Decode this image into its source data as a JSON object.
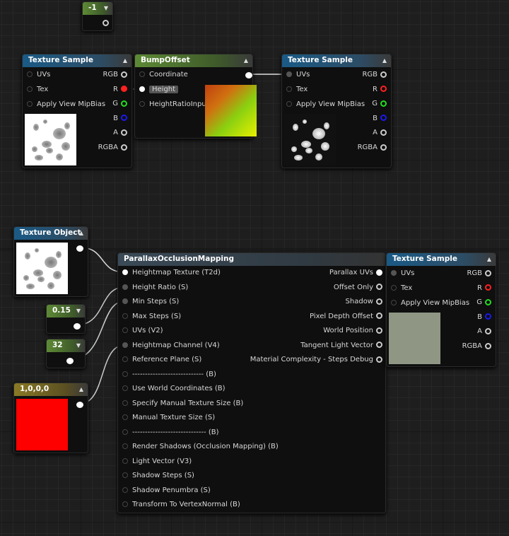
{
  "nodes": {
    "const_neg1": {
      "value": "-1"
    },
    "tex1": {
      "title": "Texture Sample",
      "inputs": [
        "UVs",
        "Tex",
        "Apply View MipBias"
      ],
      "outputs": [
        "RGB",
        "R",
        "G",
        "B",
        "A",
        "RGBA"
      ]
    },
    "bump": {
      "title": "BumpOffset",
      "inputs": [
        "Coordinate",
        "Height",
        "HeightRatioInput"
      ]
    },
    "tex2": {
      "title": "Texture Sample",
      "inputs": [
        "UVs",
        "Tex",
        "Apply View MipBias"
      ],
      "outputs": [
        "RGB",
        "R",
        "G",
        "B",
        "A",
        "RGBA"
      ]
    },
    "texobj": {
      "title": "Texture Object"
    },
    "const_015": {
      "value": "0.15"
    },
    "const_32": {
      "value": "32"
    },
    "vec4": {
      "title": "1,0,0,0"
    },
    "pom": {
      "title": "ParallaxOcclusionMapping",
      "inputs": [
        "Heightmap Texture (T2d)",
        "Height Ratio (S)",
        "Min Steps (S)",
        "Max Steps (S)",
        "UVs (V2)",
        "Heightmap Channel (V4)",
        "Reference Plane (S)",
        "---------------------------- (B)",
        "Use World Coordinates (B)",
        "Specify Manual Texture Size (B)",
        "Manual Texture Size (S)",
        "----------------------------- (B)",
        "Render Shadows (Occlusion Mapping) (B)",
        "Light Vector (V3)",
        "Shadow Steps (S)",
        "Shadow Penumbra (S)",
        "Transform To VertexNormal (B)"
      ],
      "outputs": [
        "Parallax UVs",
        "Offset Only",
        "Shadow",
        "Pixel Depth Offset",
        "World Position",
        "Tangent Light Vector",
        "Material Complexity - Steps Debug"
      ]
    },
    "tex3": {
      "title": "Texture Sample",
      "inputs": [
        "UVs",
        "Tex",
        "Apply View MipBias"
      ],
      "outputs": [
        "RGB",
        "R",
        "G",
        "B",
        "A",
        "RGBA"
      ]
    }
  },
  "colors": {
    "r": "#ff2020",
    "g": "#22dd22",
    "b": "#1a1aee",
    "preview_tex3": "#8f9784",
    "vec4": "#ff0000"
  }
}
